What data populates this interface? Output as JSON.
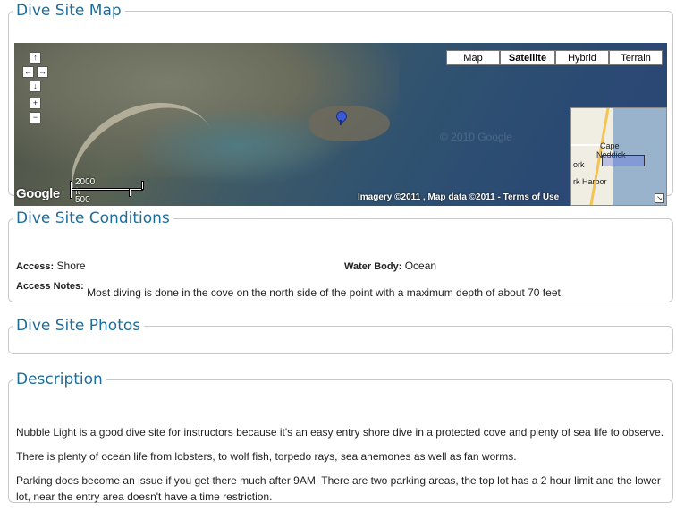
{
  "map_section": {
    "legend": "Dive Site Map",
    "map_types": [
      "Map",
      "Satellite",
      "Hybrid",
      "Terrain"
    ],
    "active_map_type": "Satellite",
    "nav": {
      "up": "↑",
      "left": "←",
      "right": "→",
      "down": "↓",
      "zoom_in": "+",
      "zoom_out": "−"
    },
    "scale": {
      "top_label": "2000 ft",
      "bottom_label": "500 m"
    },
    "google_logo": "Google",
    "copyright": {
      "imagery": "Imagery ©2011",
      "map_data": ", Map data ©2011 -",
      "terms": "Terms of Use"
    },
    "overview_labels": {
      "cape": "Cape",
      "neddick": "Neddick",
      "york": "ork",
      "harbor": "rk Harbor"
    },
    "watermark": "© 2010 Google"
  },
  "conditions": {
    "legend": "Dive Site Conditions",
    "access_label": "Access:",
    "access_value": "Shore",
    "water_body_label": "Water Body:",
    "water_body_value": "Ocean",
    "access_notes_label": "Access Notes:",
    "access_notes_value": "Most diving is done in the cove on the north side of the point with a maximum depth of about 70 feet."
  },
  "photos": {
    "legend": "Dive Site Photos"
  },
  "description": {
    "legend": "Description",
    "paragraphs": [
      "Nubble Light is a good dive site for instructors because it's an easy entry shore dive in a protected cove and plenty of sea life to observe.",
      "There is plenty of ocean life from lobsters, to wolf fish, torpedo rays, sea anemones as well as fan worms.",
      "Parking does become an issue if you get there much after 9AM. There are two parking areas, the top lot has a 2 hour limit and the lower lot, near the entry area doesn't have a time restriction."
    ]
  },
  "colors": {
    "heading": "#1f6c9a",
    "border": "#c9c9c9",
    "pin": "#3b5bd6"
  }
}
